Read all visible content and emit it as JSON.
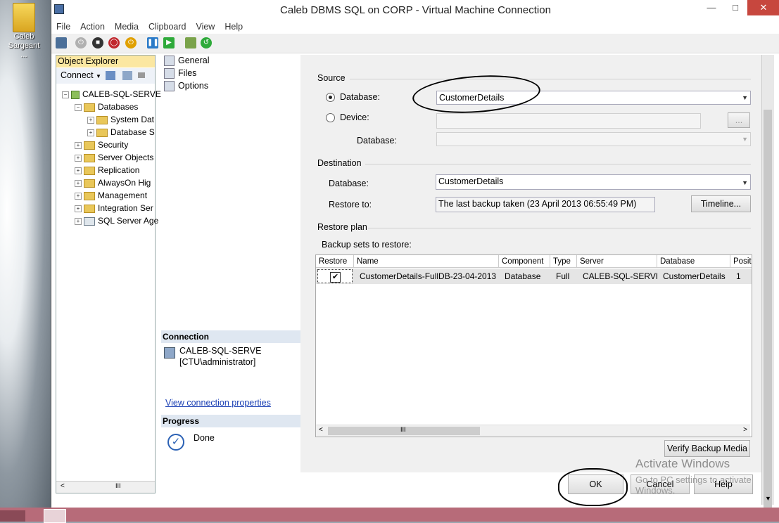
{
  "desktop": {
    "icon_label": "Caleb Sargeant ..."
  },
  "window": {
    "title": "Caleb DBMS SQL on CORP - Virtual Machine Connection"
  },
  "menu": [
    "File",
    "Action",
    "Media",
    "Clipboard",
    "View",
    "Help"
  ],
  "object_explorer": {
    "title": "Object Explorer",
    "connect_label": "Connect",
    "tree": [
      {
        "label": "CALEB-SQL-SERVE",
        "level": 0
      },
      {
        "label": "Databases",
        "level": 1
      },
      {
        "label": "System Dat",
        "level": 2
      },
      {
        "label": "Database S",
        "level": 2
      },
      {
        "label": "Security",
        "level": 1
      },
      {
        "label": "Server Objects",
        "level": 1
      },
      {
        "label": "Replication",
        "level": 1
      },
      {
        "label": "AlwaysOn Hig",
        "level": 1
      },
      {
        "label": "Management",
        "level": 1
      },
      {
        "label": "Integration Ser",
        "level": 1
      },
      {
        "label": "SQL Server Age",
        "level": 1
      }
    ]
  },
  "pages": {
    "items": [
      "General",
      "Files",
      "Options"
    ],
    "connection_heading": "Connection",
    "server": "CALEB-SQL-SERVE",
    "user": "[CTU\\administrator]",
    "view_link": "View connection properties",
    "progress_heading": "Progress",
    "progress_status": "Done"
  },
  "source": {
    "heading": "Source",
    "database_label": "Database:",
    "database_value": "CustomerDetails",
    "device_label": "Device:",
    "browse_label": "...",
    "device_db_label": "Database:"
  },
  "destination": {
    "heading": "Destination",
    "database_label": "Database:",
    "database_value": "CustomerDetails",
    "restore_to_label": "Restore to:",
    "restore_to_value": "The last backup taken (23 April 2013 06:55:49 PM)",
    "timeline_button": "Timeline..."
  },
  "restore_plan": {
    "heading": "Restore plan",
    "backup_sets_label": "Backup sets to restore:",
    "columns": [
      "Restore",
      "Name",
      "Component",
      "Type",
      "Server",
      "Database",
      "Positi"
    ],
    "rows": [
      {
        "restore": "checked",
        "name": "CustomerDetails-FullDB-23-04-2013",
        "component": "Database",
        "type": "Full",
        "server": "CALEB-SQL-SERVE",
        "database": "CustomerDetails",
        "position": "1"
      }
    ],
    "scroll_grip": "III"
  },
  "buttons": {
    "verify": "Verify Backup Media",
    "ok": "OK",
    "cancel": "Cancel",
    "help": "Help"
  },
  "watermark": {
    "line1": "Activate Windows",
    "line2": "Go to PC settings to activate Windows."
  },
  "oe_scroll_grip": "III",
  "colors": {
    "close_button": "#c7473e",
    "taskbar": "#b76b79",
    "oe_header": "#fbe7a1",
    "section_header": "#dfe7f1"
  }
}
